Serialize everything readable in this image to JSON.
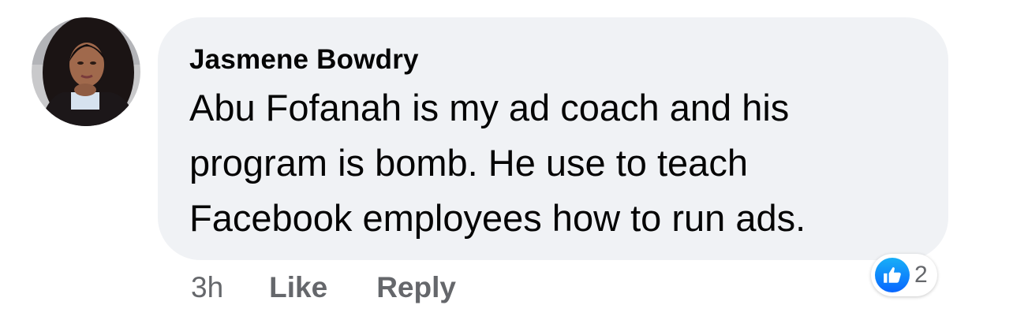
{
  "comment": {
    "author": "Jasmene Bowdry",
    "text": "Abu Fofanah is my ad coach and his program is bomb. He use to teach Facebook employees how to run ads.",
    "timestamp": "3h",
    "like_label": "Like",
    "reply_label": "Reply",
    "reaction_count": "2",
    "reaction_icon": "thumbs-up-icon"
  },
  "colors": {
    "bubble": "#f0f2f5",
    "text": "#050505",
    "secondary": "#65676b",
    "like_blue": "#0866ff"
  }
}
